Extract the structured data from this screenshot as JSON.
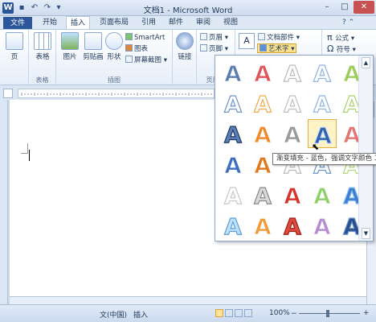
{
  "window": {
    "title": "文档1 - Microsoft Word",
    "app_icon": "W",
    "controls": [
      "–",
      "□",
      "✕"
    ]
  },
  "quick_access": [
    "save-icon",
    "undo-icon",
    "redo-icon",
    "dropdown-icon"
  ],
  "tabs": [
    {
      "label": "文件"
    },
    {
      "label": "开始"
    },
    {
      "label": "插入"
    },
    {
      "label": "页面布局"
    },
    {
      "label": "引用"
    },
    {
      "label": "邮件"
    },
    {
      "label": "审阅"
    },
    {
      "label": "视图"
    }
  ],
  "ribbon": {
    "pages_group": {
      "button": "页"
    },
    "tables_group": {
      "label": "表格",
      "button": "表格"
    },
    "illustrations_group": {
      "label": "插图",
      "picture": "图片",
      "clipart": "剪贴画",
      "shapes": "形状",
      "smartart": "SmartArt",
      "chart": "图表",
      "screenshot": "屏幕截图"
    },
    "links_group": {
      "button": "链接"
    },
    "header_footer_group": {
      "label": "页眉和",
      "header": "页眉",
      "footer": "页脚"
    },
    "text_group": {
      "quickparts": "文档部件",
      "wordart": "艺术字"
    },
    "symbols_group": {
      "equation": "公式",
      "symbol": "符号"
    }
  },
  "wordart_tooltip": "渐变填充 - 蓝色，强调文字颜色 1",
  "wordart_styles_count": 30,
  "selected_style_index": 13,
  "status": {
    "language": "文(中国)",
    "mode": "插入",
    "zoom": "100%"
  }
}
